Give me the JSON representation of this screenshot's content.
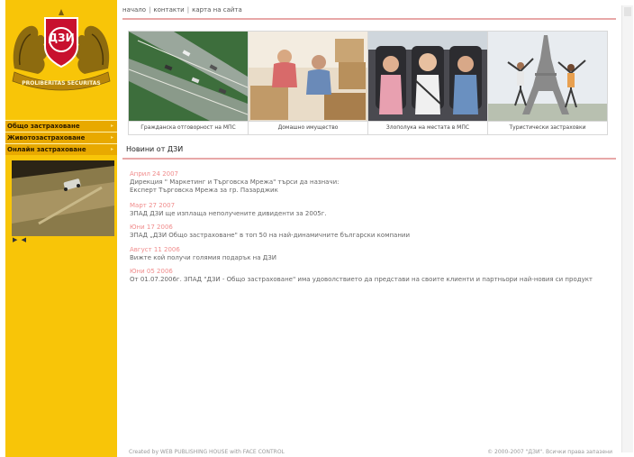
{
  "logo": {
    "monogram": "ДЗИ",
    "motto": "PROLIBERITAS SECURITAS"
  },
  "sidebar": {
    "items": [
      {
        "label": "Общо застраховане",
        "arrow": "▸"
      },
      {
        "label": "Животозастраховане",
        "arrow": "▸"
      },
      {
        "label": "Онлайн застраховане",
        "arrow": "▸"
      }
    ],
    "video_controls": "▶ ◀"
  },
  "topnav": {
    "links": [
      "начало",
      "контакти",
      "карта на сайта"
    ],
    "separator": "|"
  },
  "tiles": [
    {
      "caption": "Гражданска отговорност на МПС"
    },
    {
      "caption": "Домашно имущество"
    },
    {
      "caption": "Злополука на местата в МПС"
    },
    {
      "caption": "Туристически застраховки"
    }
  ],
  "news": {
    "heading": "Новини от ДЗИ",
    "items": [
      {
        "date": "Април 24 2007",
        "text": "Дирекция \" Маркетинг и Търговска Мрежа\" търси да назначи: Експерт Търговска Мрежа за гр. Пазарджик"
      },
      {
        "date": "Март 27 2007",
        "text": "ЗПАД ДЗИ ще изплаща неполучените дивиденти за 2005г."
      },
      {
        "date": "Юни 17 2006",
        "text": "ЗПАД „ДЗИ Общо застраховане\" в топ 50 на най-динамичните български компании"
      },
      {
        "date": "Август 11 2006",
        "text": "Вижте кой получи голямия подарък на ДЗИ"
      },
      {
        "date": "Юни 05 2006",
        "text": "От 01.07.2006г. ЗПАД \"ДЗИ - Общо застраховане\" има удоволствието да представи на своите клиенти и партньори най-новия си продукт"
      }
    ]
  },
  "footer": {
    "left": "Created by WEB PUBLISHING HOUSE with FACE CONTROL",
    "right": "© 2000-2007 \"ДЗИ\". Всички права запазени"
  }
}
